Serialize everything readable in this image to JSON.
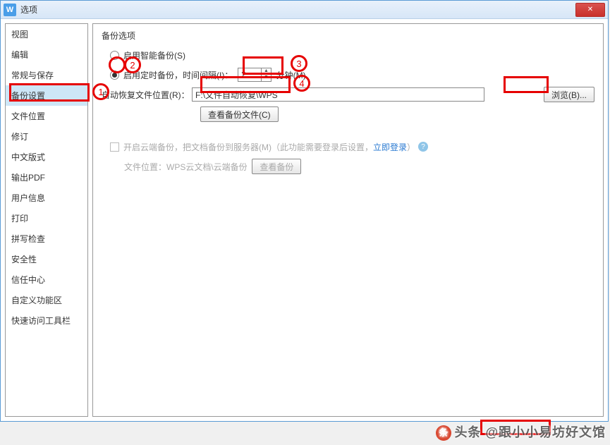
{
  "title": "选项",
  "logo_text": "W",
  "sidebar": {
    "items": [
      {
        "label": "视图"
      },
      {
        "label": "编辑"
      },
      {
        "label": "常规与保存"
      },
      {
        "label": "备份设置"
      },
      {
        "label": "文件位置"
      },
      {
        "label": "修订"
      },
      {
        "label": "中文版式"
      },
      {
        "label": "输出PDF"
      },
      {
        "label": "用户信息"
      },
      {
        "label": "打印"
      },
      {
        "label": "拼写检查"
      },
      {
        "label": "安全性"
      },
      {
        "label": "信任中心"
      },
      {
        "label": "自定义功能区"
      },
      {
        "label": "快速访问工具栏"
      }
    ],
    "active_index": 3
  },
  "main": {
    "section_title": "备份选项",
    "smart_backup": {
      "label": "启用智能备份(S)"
    },
    "timed_backup": {
      "label_pre": "启用定时备份，时间间隔(I)：",
      "value": "2",
      "unit": "分钟(M)"
    },
    "recover_path": {
      "label": "自动恢复文件位置(R)：",
      "value": "F:\\文件自动恢复\\WPS",
      "browse": "浏览(B)..."
    },
    "view_backup_btn": "查看备份文件(C)",
    "cloud": {
      "text": "开启云端备份，把文档备份到服务器(M)（此功能需要登录后设置，",
      "link": "立即登录",
      "tail": "）"
    },
    "cloud_path": {
      "label": "文件位置：",
      "value": "WPS云文档\\云端备份",
      "btn": "查看备份"
    }
  },
  "annotations": {
    "n1": "1",
    "n2": "2",
    "n3": "3",
    "n4": "4"
  },
  "watermark": {
    "text": "头条 @跟小小易坊好文馆"
  }
}
